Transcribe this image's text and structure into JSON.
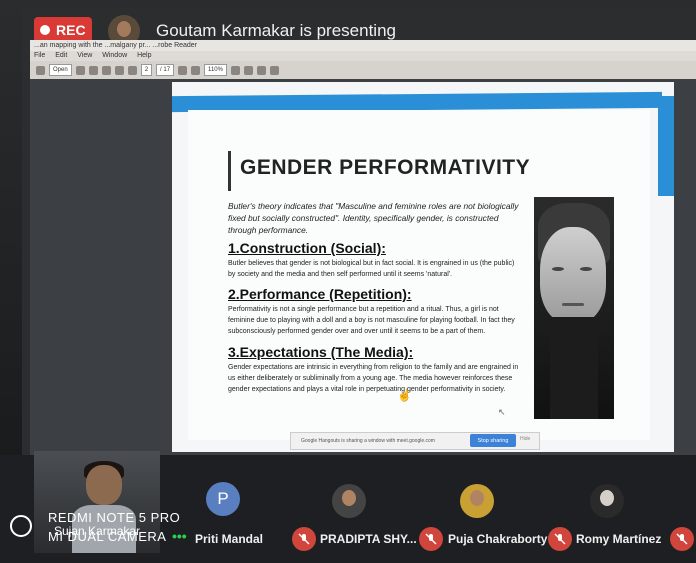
{
  "meeting": {
    "rec_label": "REC",
    "presenter_text": "Goutam Karmakar is presenting"
  },
  "app": {
    "titlebar_text": "...an mapping with the ...malgany pr... ...robe Reader",
    "menu": [
      "File",
      "Edit",
      "View",
      "Window",
      "Help"
    ],
    "toolbar": {
      "open_label": "Open",
      "page": "2",
      "page_total": "/ 17",
      "zoom": "110%"
    }
  },
  "slide": {
    "title": "GENDER PERFORMATIVITY",
    "intro": "Butler's theory indicates that \"Masculine and feminine roles are not biologically fixed but socially constructed\". Identity, specifically gender, is constructed through performance.",
    "sections": [
      {
        "heading": "1.Construction (Social):",
        "body": "Butler believes that gender is not biological but in fact social. It is engrained in us (the public) by society and the media and then self performed until it seems 'natural'."
      },
      {
        "heading": "2.Performance (Repetition):",
        "body": "Performativity is not a single performance but a repetition and a ritual. Thus, a girl is not feminine due to playing with a doll and a boy is not masculine for playing football. In fact they subconsciously performed gender over and over until it seems to be a part of them."
      },
      {
        "heading": "3.Expectations (The Media):",
        "body": "Gender expectations are intrinsic in everything from religion to the family and are engrained in us either deliberately or subliminally from a young age. The media however reinforces these gender expectations and plays a vital role in perpetuating gender performativity in society."
      }
    ]
  },
  "sharebar": {
    "text": "Google Hangouts is sharing a window with meet.google.com",
    "stop_label": "Stop sharing",
    "hide_label": "Hide"
  },
  "participants": {
    "self_name": "Sujan Karmakar",
    "items": [
      {
        "name": "Priti Mandal",
        "initial": "P"
      },
      {
        "name": "PRADIPTA SHY..."
      },
      {
        "name": "Puja Chakraborty"
      },
      {
        "name": "Romy Martínez"
      }
    ]
  },
  "watermark": {
    "line1": "REDMI NOTE 5 PRO",
    "line2": "MI DUAL CAMERA"
  },
  "colors": {
    "rec": "#d93a36",
    "accent_band": "#2a8fd6",
    "mute": "#d0453c"
  }
}
